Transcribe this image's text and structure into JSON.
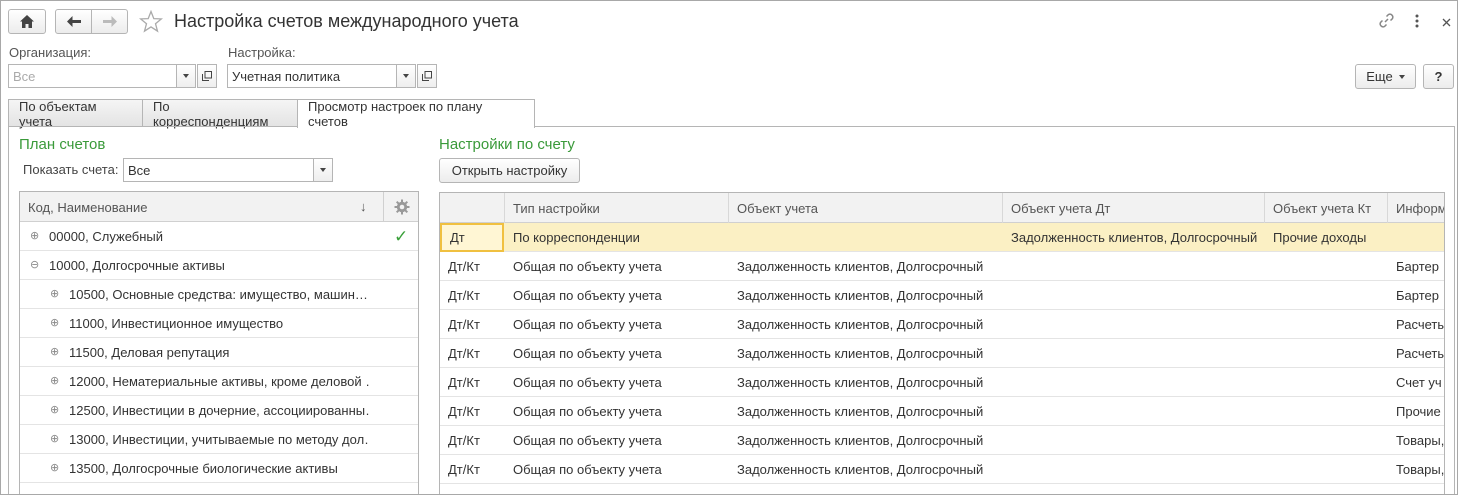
{
  "header": {
    "title": "Настройка счетов международного учета",
    "more_label": "Еще",
    "help_label": "?"
  },
  "filters": {
    "org_label": "Организация:",
    "org_placeholder": "Все",
    "setting_label": "Настройка:",
    "setting_value": "Учетная политика"
  },
  "tabs": [
    {
      "label": "По объектам учета"
    },
    {
      "label": "По корреспонденциям"
    },
    {
      "label": "Просмотр настроек по плану счетов"
    }
  ],
  "left": {
    "title": "План счетов",
    "show_label": "Показать счета:",
    "show_value": "Все",
    "column_header": "Код, Наименование",
    "sort_icon": "↓",
    "rows": [
      {
        "text": "00000, Служебный",
        "expand": "⊕",
        "check": "✓"
      },
      {
        "text": "10000, Долгосрочные активы",
        "expand": "⊖",
        "check": ""
      },
      {
        "text": "10500, Основные средства: имущество, машин…",
        "expand": "⊕",
        "check": ""
      },
      {
        "text": "11000, Инвестиционное имущество",
        "expand": "⊕",
        "check": ""
      },
      {
        "text": "11500, Деловая репутация",
        "expand": "⊕",
        "check": ""
      },
      {
        "text": "12000, Нематериальные активы, кроме деловой …",
        "expand": "⊕",
        "check": ""
      },
      {
        "text": "12500, Инвестиции в дочерние, ассоциированны…",
        "expand": "⊕",
        "check": ""
      },
      {
        "text": "13000, Инвестиции, учитываемые по методу дол…",
        "expand": "⊕",
        "check": ""
      },
      {
        "text": "13500, Долгосрочные биологические активы",
        "expand": "⊕",
        "check": ""
      }
    ]
  },
  "right": {
    "title": "Настройки по счету",
    "open_button": "Открыть настройку",
    "columns": [
      "",
      "Тип настройки",
      "Объект учета",
      "Объект учета Дт",
      "Объект учета Кт",
      "Информ"
    ],
    "rows": [
      [
        "Дт",
        "По корреспонденции",
        "",
        "Задолженность клиентов, Долгосрочный",
        "Прочие доходы",
        ""
      ],
      [
        "Дт/Кт",
        "Общая по объекту учета",
        "Задолженность клиентов, Долгосрочный",
        "",
        "",
        "Бартер"
      ],
      [
        "Дт/Кт",
        "Общая по объекту учета",
        "Задолженность клиентов, Долгосрочный",
        "",
        "",
        "Бартер"
      ],
      [
        "Дт/Кт",
        "Общая по объекту учета",
        "Задолженность клиентов, Долгосрочный",
        "",
        "",
        "Расчеты"
      ],
      [
        "Дт/Кт",
        "Общая по объекту учета",
        "Задолженность клиентов, Долгосрочный",
        "",
        "",
        "Расчеты"
      ],
      [
        "Дт/Кт",
        "Общая по объекту учета",
        "Задолженность клиентов, Долгосрочный",
        "",
        "",
        "Счет уч"
      ],
      [
        "Дт/Кт",
        "Общая по объекту учета",
        "Задолженность клиентов, Долгосрочный",
        "",
        "",
        "Прочие"
      ],
      [
        "Дт/Кт",
        "Общая по объекту учета",
        "Задолженность клиентов, Долгосрочный",
        "",
        "",
        "Товары,"
      ],
      [
        "Дт/Кт",
        "Общая по объекту учета",
        "Задолженность клиентов, Долгосрочный",
        "",
        "",
        "Товары,"
      ]
    ]
  }
}
